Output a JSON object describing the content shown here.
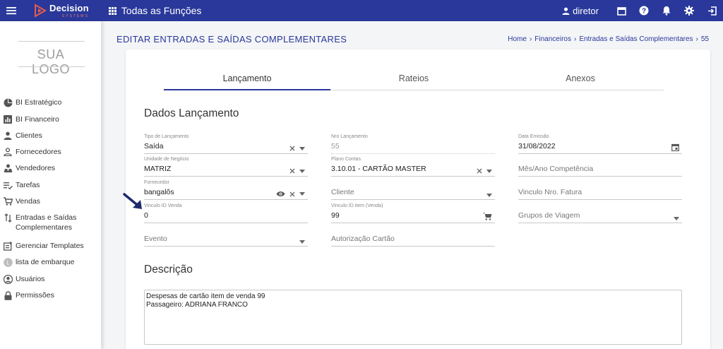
{
  "topbar": {
    "logo_name": "Decision",
    "logo_sub": "SYSTEMS",
    "all_functions": "Todas as Funções",
    "user": "diretor",
    "icons": [
      "menu-icon",
      "grid-icon",
      "person-icon",
      "calendar-icon",
      "help-icon",
      "bell-icon",
      "gear-icon",
      "logout-icon"
    ]
  },
  "sidebar": {
    "logo": "SUA LOGO",
    "items": [
      {
        "label": "BI Estratégico",
        "icon": "pie-chart-icon"
      },
      {
        "label": "BI Financeiro",
        "icon": "bar-chart-icon"
      },
      {
        "label": "Clientes",
        "icon": "person-icon"
      },
      {
        "label": "Fornecedores",
        "icon": "person-outline-icon"
      },
      {
        "label": "Vendedores",
        "icon": "seller-icon"
      },
      {
        "label": "Tarefas",
        "icon": "task-list-icon"
      },
      {
        "label": "Vendas",
        "icon": "cart-icon"
      },
      {
        "label": "Entradas e Saídas",
        "label2": "Complementares",
        "icon": "swap-vertical-icon"
      },
      {
        "label": "Gerenciar Templates",
        "icon": "template-icon"
      },
      {
        "label": "lista de embarque",
        "icon": "letter-l-icon",
        "icon_text": "L"
      },
      {
        "label": "Usuários",
        "icon": "account-circle-icon"
      },
      {
        "label": "Permissões",
        "icon": "lock-icon"
      }
    ]
  },
  "page": {
    "title": "EDITAR ENTRADAS E SAÍDAS COMPLEMENTARES",
    "breadcrumb": [
      "Home",
      "Financeiros",
      "Entradas e Saídas Complementares",
      "55"
    ],
    "breadcrumb_sep": "›"
  },
  "tabs": [
    "Lançamento",
    "Rateios",
    "Anexos"
  ],
  "sections": {
    "dados": "Dados Lançamento",
    "descricao": "Descrição"
  },
  "form": {
    "tipo_lancamento": {
      "label": "Tipo de Lançamento",
      "value": "Saída"
    },
    "nro_lancamento": {
      "label": "Nro Lançamento",
      "value": "55"
    },
    "data_emissao": {
      "label": "Data Emissão",
      "value": "31/08/2022"
    },
    "unidade_negocio": {
      "label": "Unidade de Negócio",
      "value": "MATRIZ"
    },
    "plano_contas": {
      "label": "Plano Contas",
      "value": "3.10.01 - CARTÃO MASTER"
    },
    "mes_ano": {
      "placeholder": "Mês/Ano Competência"
    },
    "fornecedor": {
      "label": "Fornecedor",
      "value": "bangalôs"
    },
    "cliente": {
      "placeholder": "Cliente"
    },
    "vinculo_fatura": {
      "placeholder": "Vinculo Nro. Fatura"
    },
    "vinculo_venda": {
      "label": "Vinculo ID Venda",
      "value": "0"
    },
    "vinculo_item": {
      "label": "Vinculo ID item (Venda)",
      "value": "99"
    },
    "grupos_viagem": {
      "placeholder": "Grupos de Viagem"
    },
    "evento": {
      "placeholder": "Evento"
    },
    "autorizacao": {
      "placeholder": "Autorização Cartão"
    }
  },
  "descricao": "Despesas de cartão item de venda 99\nPassageiro: ADRIANA FRANCO",
  "colors": {
    "primary": "#29389a",
    "accent": "#f57c6a"
  }
}
